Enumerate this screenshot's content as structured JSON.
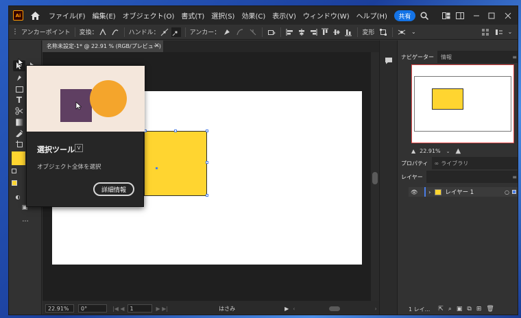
{
  "menubar": {
    "app_logo": "Ai",
    "menus": [
      "ファイル(F)",
      "編集(E)",
      "オブジェクト(O)",
      "書式(T)",
      "選択(S)",
      "効果(C)",
      "表示(V)",
      "ウィンドウ(W)",
      "ヘルプ(H)"
    ],
    "share_label": "共有"
  },
  "controlbar": {
    "tool_name": "アンカーポイント",
    "transform_label": "変換：",
    "handle_label": "ハンドル：",
    "anchor_label": "アンカー：",
    "shape_label": "変形"
  },
  "document": {
    "tab_title": "名称未設定-1* @ 22.91 % (RGB/プレビュー)"
  },
  "statusbar": {
    "zoom": "22.91%",
    "rotation": "0°",
    "artboard_number": "1",
    "tool_status": "はさみ"
  },
  "navigator": {
    "tabs": [
      "ナビゲーター",
      "情報"
    ],
    "zoom": "22.91%"
  },
  "properties_tabs": [
    "プロパティ",
    "ライブラリ"
  ],
  "layers": {
    "tab": "レイヤー",
    "layer_name": "レイヤー 1",
    "count_label": "1 レイ..."
  },
  "tooltip": {
    "title": "選択ツール",
    "shortcut": "V",
    "description": "オブジェクト全体を選択",
    "button_label": "詳細情報"
  },
  "colors": {
    "accent": "#1473e6",
    "object_yellow": "#ffd530",
    "tooltip_purple": "#5f3f62",
    "tooltip_orange": "#f4a52c",
    "layer_color": "#4a7de8"
  }
}
